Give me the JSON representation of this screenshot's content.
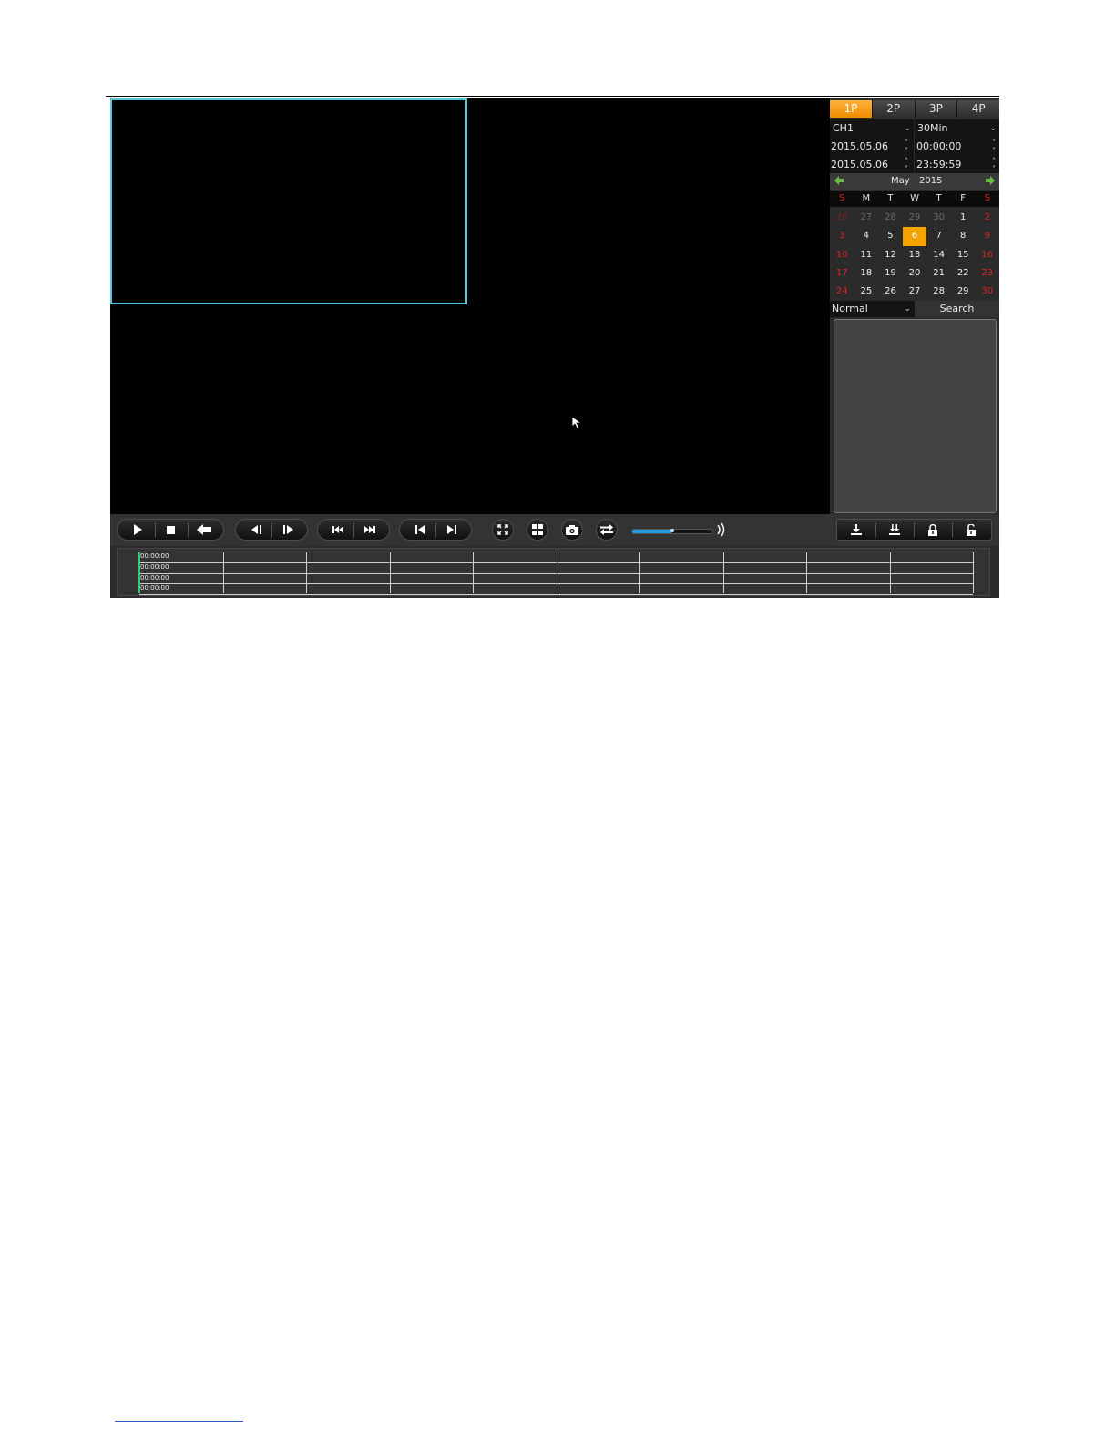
{
  "split_tabs": [
    "1P",
    "2P",
    "3P",
    "4P"
  ],
  "active_split": "1P",
  "channel": "CH1",
  "duration": "30Min",
  "start": {
    "date": "2015.05.06",
    "time": "00:00:00"
  },
  "end": {
    "date": "2015.05.06",
    "time": "23:59:59"
  },
  "calendar": {
    "month": "May",
    "year": "2015",
    "weekdays": [
      "S",
      "M",
      "T",
      "W",
      "T",
      "F",
      "S"
    ],
    "weeks": [
      [
        "26",
        "27",
        "28",
        "29",
        "30",
        "1",
        "2"
      ],
      [
        "3",
        "4",
        "5",
        "6",
        "7",
        "8",
        "9"
      ],
      [
        "10",
        "11",
        "12",
        "13",
        "14",
        "15",
        "16"
      ],
      [
        "17",
        "18",
        "19",
        "20",
        "21",
        "22",
        "23"
      ],
      [
        "24",
        "25",
        "26",
        "27",
        "28",
        "29",
        "30"
      ]
    ],
    "selected_day": "6",
    "accent_color": "#f5a300",
    "weekend_color": "#dd2222"
  },
  "record_type": "Normal",
  "search_label": "Search",
  "volume_level": 0.5,
  "timeline": {
    "channel_times": [
      "00:00:00",
      "00:00:00",
      "00:00:00",
      "00:00:00"
    ],
    "marker_color": "#2ed06a"
  },
  "selection_color": "#53c7d8",
  "volume_color": "#1e9ee6",
  "icons": [
    "play-icon",
    "stop-icon",
    "back-icon",
    "step-back-icon",
    "step-forward-icon",
    "slow-icon",
    "fast-icon",
    "previous-file-icon",
    "next-file-icon",
    "fullscreen-icon",
    "split-icon",
    "snapshot-icon",
    "switch-icon",
    "speaker-icon",
    "download-icon",
    "batch-download-icon",
    "lock-icon",
    "unlock-icon"
  ]
}
